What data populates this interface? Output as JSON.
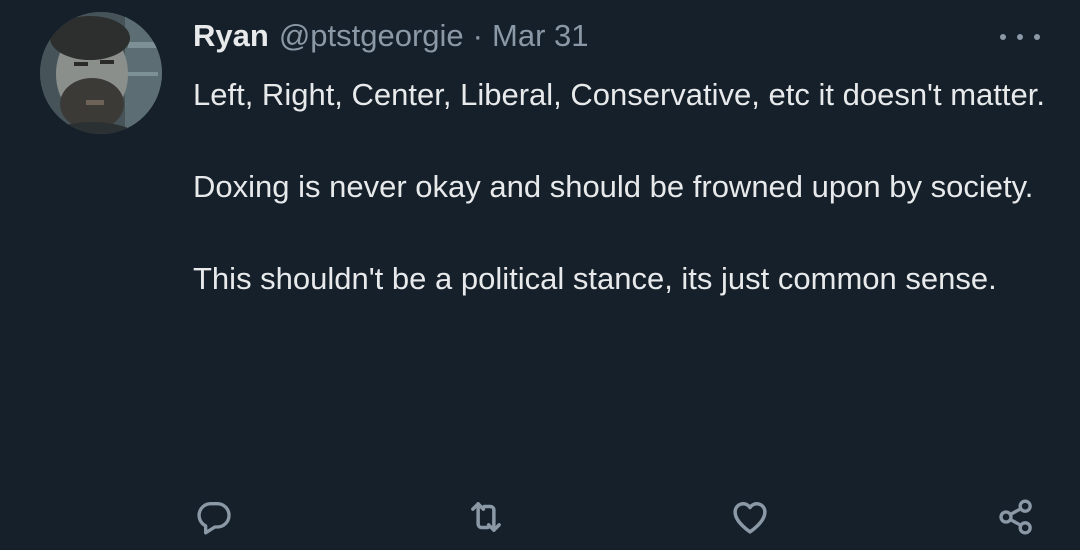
{
  "tweet": {
    "author_name": "Ryan",
    "handle": "@ptstgeorgie",
    "separator": "·",
    "date": "Mar 31",
    "paragraphs": [
      "Left, Right, Center, Liberal, Conservative, etc it doesn't matter.",
      "Doxing is never okay and should be frowned upon by society.",
      "This shouldn't be a political stance, its just common sense."
    ]
  },
  "icons": {
    "avatar": "avatar-photo",
    "more": "more-dots-icon",
    "reply": "reply-icon",
    "retweet": "retweet-icon",
    "like": "like-icon",
    "share": "share-icon"
  },
  "colors": {
    "background": "#15202b",
    "text": "#e7e9ea",
    "secondary": "#8b98a5"
  }
}
